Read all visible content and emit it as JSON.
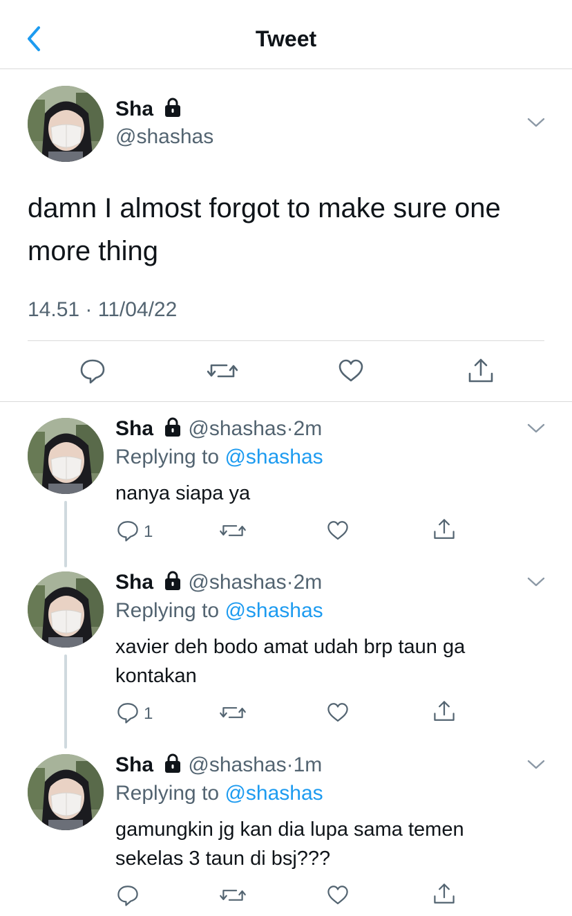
{
  "header": {
    "title": "Tweet"
  },
  "main_tweet": {
    "name": "Sha",
    "handle": "@shashas",
    "text": "damn I almost forgot to make sure one more thing",
    "timestamp": "14.51 · 11/04/22",
    "locked": true
  },
  "replies": [
    {
      "name": "Sha",
      "handle": "@shashas",
      "time": "2m",
      "replying_label": "Replying to",
      "replying_to": "@shashas",
      "text": "nanya siapa ya",
      "reply_count": "1"
    },
    {
      "name": "Sha",
      "handle": "@shashas",
      "time": "2m",
      "replying_label": "Replying to",
      "replying_to": "@shashas",
      "text": "xavier deh bodo amat udah brp taun ga kontakan",
      "reply_count": "1"
    },
    {
      "name": "Sha",
      "handle": "@shashas",
      "time": "1m",
      "replying_label": "Replying to",
      "replying_to": "@shashas",
      "text": "gamungkin jg kan dia lupa sama temen sekelas 3 taun di bsj???",
      "reply_count": ""
    }
  ],
  "icons": [
    "back-icon",
    "lock-icon",
    "chevron-down-icon",
    "reply-icon",
    "retweet-icon",
    "like-icon",
    "share-icon"
  ],
  "colors": {
    "accent": "#1d9bf0",
    "secondary_text": "#536471",
    "divider": "#d9d9d9"
  }
}
